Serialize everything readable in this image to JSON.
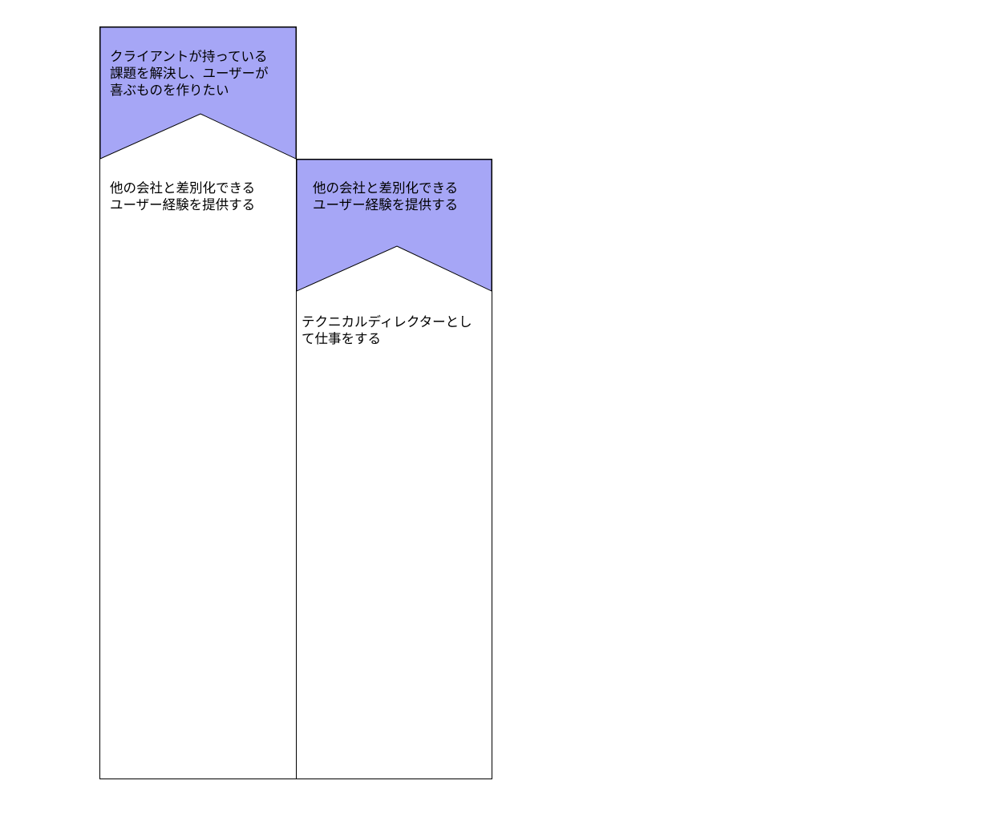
{
  "diagram": {
    "colors": {
      "header_fill": "#a6a6f6",
      "border": "#000000",
      "background": "#ffffff"
    },
    "columns": [
      {
        "header_text": "クライアントが持っている\n課題を解決し、ユーザーが\n喜ぶものを作りたい",
        "body_text": "他の会社と差別化できる\nユーザー経験を提供する"
      },
      {
        "header_text": "他の会社と差別化できる\nユーザー経験を提供する",
        "body_text": "テクニカルディレクターとし\nて仕事をする"
      }
    ]
  }
}
